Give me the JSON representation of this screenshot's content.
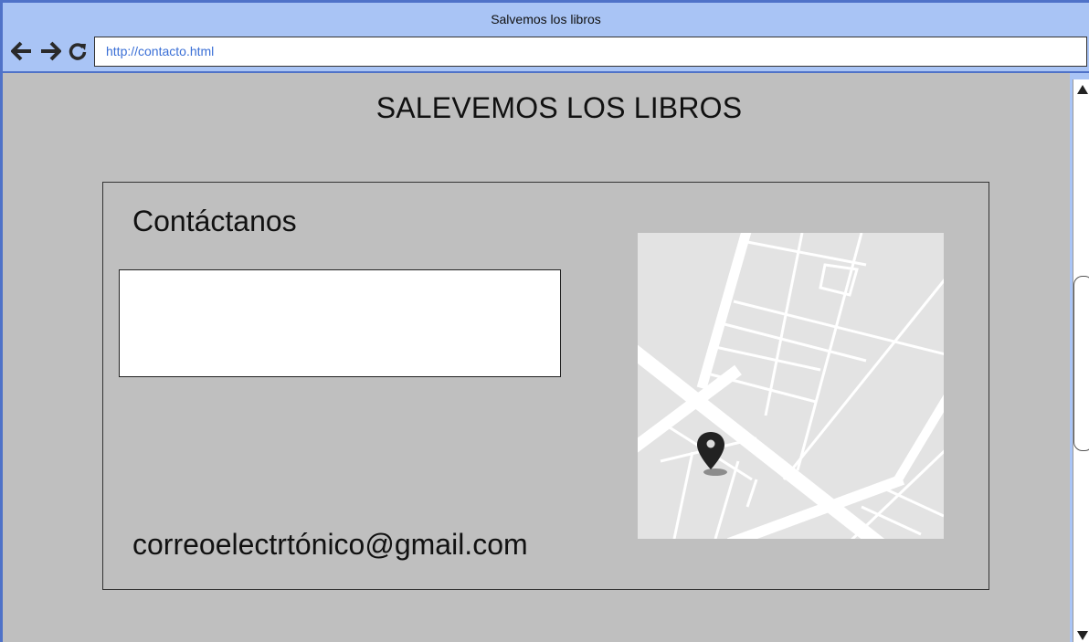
{
  "browser": {
    "window_title": "Salvemos los libros",
    "url": "http://contacto.html",
    "back_icon": "arrow-left-icon",
    "forward_icon": "arrow-right-icon",
    "reload_icon": "reload-icon"
  },
  "page": {
    "site_title": "SALEVEMOS LOS LIBROS",
    "contact": {
      "heading": "Contáctanos",
      "message_box_value": "",
      "email": "correoelectrtónico@gmail.com",
      "map_icon": "location-pin-icon"
    }
  },
  "colors": {
    "window_frame": "#4f72c8",
    "titlebar": "#a9c4f5",
    "page_background": "#bfbfbf",
    "url_text": "#3a6fd6"
  }
}
